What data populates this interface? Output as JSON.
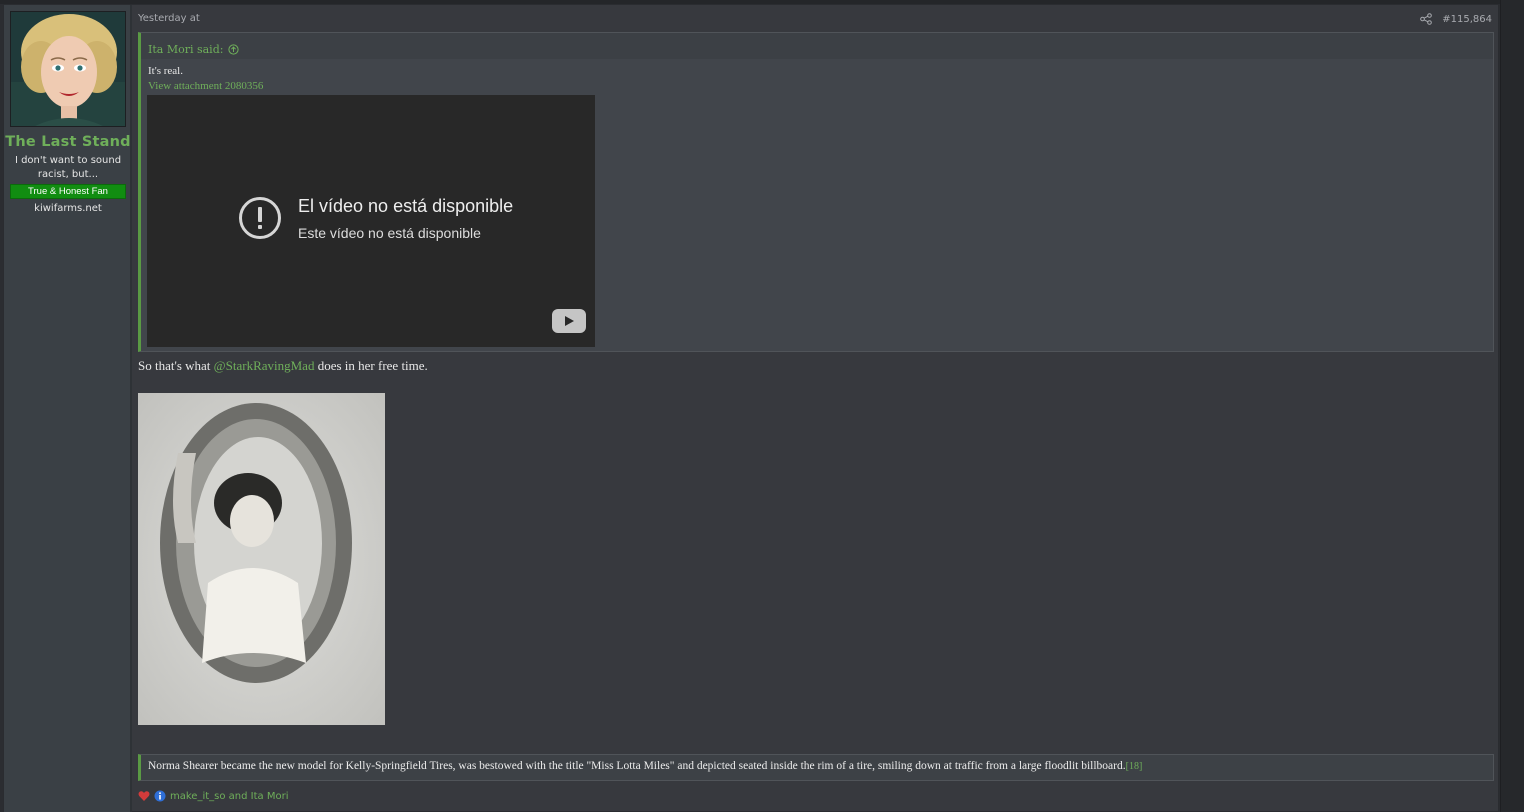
{
  "user": {
    "name": "The Last Stand",
    "title": "I don't want to sound racist, but...",
    "banner": "True & Honest Fan",
    "extra": "kiwifarms.net"
  },
  "post": {
    "date": "Yesterday at",
    "number": "#115,864",
    "quote": {
      "author": "Ita Mori said:",
      "text": "It's real.",
      "attachment_link": "View attachment 2080356",
      "video": {
        "title": "El vídeo no está disponible",
        "subtitle": "Este vídeo no está disponible"
      }
    },
    "body": {
      "before": "So that's what ",
      "mention": "@StarkRavingMad",
      "after": " does in her free time."
    },
    "caption": {
      "text": "Norma Shearer became the new model for Kelly-Springfield Tires, was bestowed with the title \"Miss Lotta Miles\" and depicted seated inside the rim of a tire, smiling down at traffic from a large floodlit billboard.",
      "cite": "[18]"
    },
    "reactions": "make_it_so and Ita Mori"
  },
  "icons": {
    "share": "share-icon",
    "quote_jump": "arrow-up-circle-icon",
    "video_warning": "exclamation-circle-icon",
    "youtube": "youtube-logo-icon",
    "reaction_love": "heart-icon",
    "reaction_info": "info-icon"
  },
  "colors": {
    "accent": "#6faf5a",
    "banner": "#118d11",
    "post_bg": "#37393e",
    "sidebar_bg": "#3a4045"
  }
}
